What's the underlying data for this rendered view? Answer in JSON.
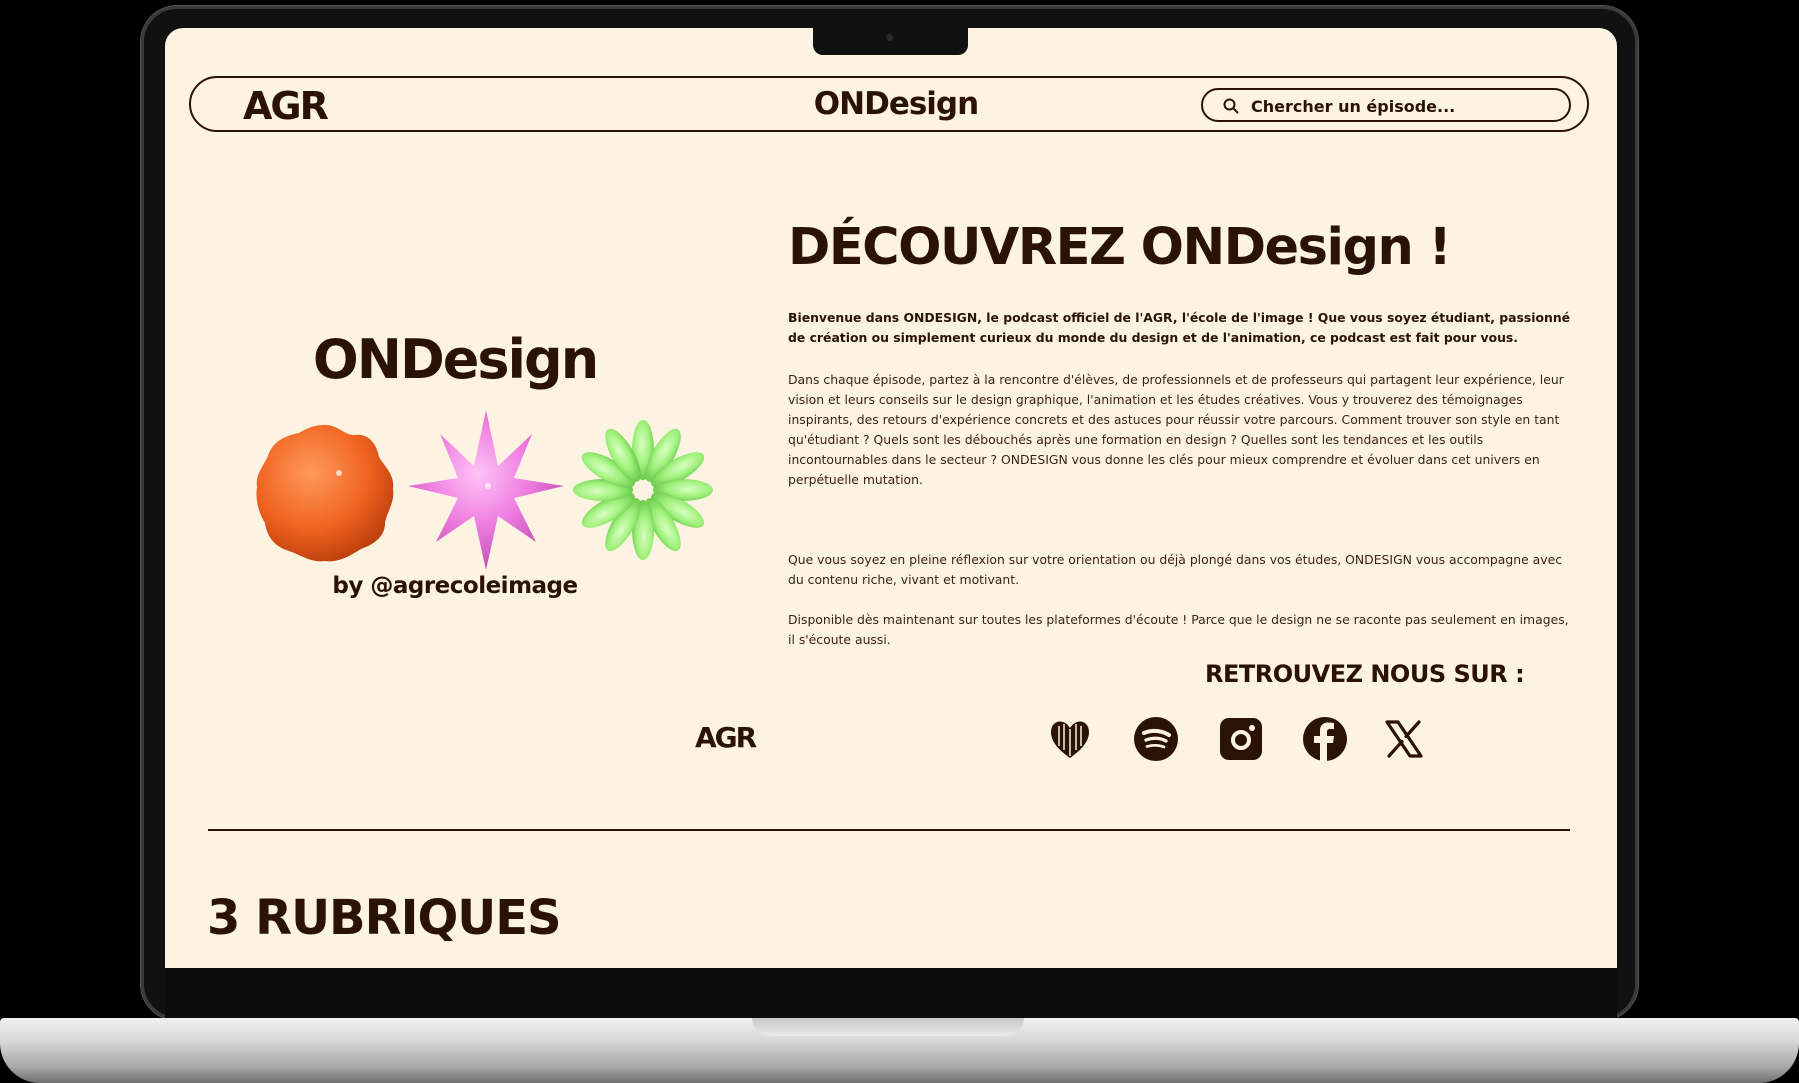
{
  "header": {
    "logo": "AGR",
    "title": "ONDesign",
    "search_placeholder": "Chercher un épisode..."
  },
  "brand": {
    "title": "ONDesign",
    "handle": "by @agrecoleimage",
    "footer_logo": "AGR"
  },
  "hero": {
    "title": "DÉCOUVREZ ONDesign !",
    "intro": "Bienvenue dans ONDESIGN, le podcast officiel de l'AGR, l'école de l'image ! Que vous soyez étudiant, passionné de création ou simplement curieux du monde du design et de l'animation, ce podcast est fait pour vous.",
    "body_1": "Dans chaque épisode, partez à la rencontre d'élèves, de professionnels et de professeurs qui partagent leur expérience, leur vision et leurs conseils sur le design graphique, l'animation et les études créatives. Vous y trouverez des témoignages inspirants, des retours d'expérience concrets et des astuces pour réussir votre parcours. Comment trouver son style en tant qu'étudiant ? Quels sont les débouchés après une formation en design ? Quelles sont les tendances et les outils incontournables dans le secteur ? ONDESIGN vous donne les clés pour mieux comprendre et évoluer dans cet univers en perpétuelle mutation.",
    "body_2": "Que vous soyez en pleine réflexion sur votre orientation ou déjà plongé dans vos études, ONDESIGN vous accompagne avec du contenu riche, vivant et motivant.",
    "availability": "Disponible dès maintenant sur toutes les plateformes d'écoute ! Parce que le design ne se raconte pas seulement en images, il s'écoute aussi."
  },
  "social": {
    "heading": "RETROUVEZ NOUS SUR :",
    "icons": [
      "deezer-icon",
      "spotify-icon",
      "instagram-icon",
      "facebook-icon",
      "x-icon"
    ]
  },
  "section": {
    "title": "3 RUBRIQUES"
  },
  "colors": {
    "background": "#fdf3e3",
    "text": "#2a1208",
    "orange_shape": "#f26a2a",
    "pink_shape": "#ee7be0",
    "green_shape": "#9ef07a"
  }
}
